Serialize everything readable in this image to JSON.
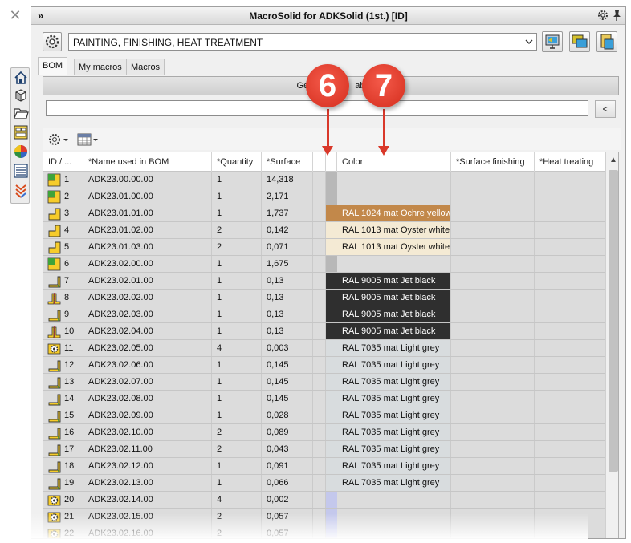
{
  "app": {
    "close_glyph": "✕",
    "title": "MacroSolid for ADKSolid (1st.) [ID]",
    "collapse_glyph": "»"
  },
  "toolbar": {
    "category_value": "PAINTING, FINISHING, HEAT TREATMENT"
  },
  "tabs": [
    {
      "label": "BOM",
      "active": true
    },
    {
      "label": "My macros",
      "active": false
    },
    {
      "label": "Macros",
      "active": false
    }
  ],
  "generate_button_label": "Ge",
  "generate_button_label_tail": "ab",
  "search": {
    "value": "",
    "back_label": "<"
  },
  "columns": [
    "ID / ...",
    "*Name used in BOM",
    "*Quantity",
    "*Surface",
    "",
    "Color",
    "*Surface finishing",
    "*Heat treating"
  ],
  "rows": [
    {
      "id": "1",
      "icon": "assembly-icon",
      "name": "ADK23.00.00.00",
      "qty": "1",
      "surface": "14,318",
      "color": "",
      "swatch": "#b8b8b8"
    },
    {
      "id": "2",
      "icon": "assembly-icon",
      "name": "ADK23.01.00.00",
      "qty": "1",
      "surface": "2,171",
      "color": "",
      "swatch": "#b8b8b8"
    },
    {
      "id": "3",
      "icon": "part-icon",
      "name": "ADK23.01.01.00",
      "qty": "1",
      "surface": "1,737",
      "color": "RAL 1024 mat Ochre yellow",
      "swatch": "#c2884a"
    },
    {
      "id": "4",
      "icon": "part-icon",
      "name": "ADK23.01.02.00",
      "qty": "2",
      "surface": "0,142",
      "color": "RAL 1013 mat Oyster white",
      "swatch": "#f4ead4"
    },
    {
      "id": "5",
      "icon": "part-icon",
      "name": "ADK23.01.03.00",
      "qty": "2",
      "surface": "0,071",
      "color": "RAL 1013 mat Oyster white",
      "swatch": "#f4ead4"
    },
    {
      "id": "6",
      "icon": "assembly-icon",
      "name": "ADK23.02.00.00",
      "qty": "1",
      "surface": "1,675",
      "color": "",
      "swatch": "#b8b8b8"
    },
    {
      "id": "7",
      "icon": "angle-icon",
      "name": "ADK23.02.01.00",
      "qty": "1",
      "surface": "0,13",
      "color": "RAL 9005 mat Jet black",
      "swatch": "#2f2f2f"
    },
    {
      "id": "8",
      "icon": "mirror-angle-icon",
      "name": "ADK23.02.02.00",
      "qty": "1",
      "surface": "0,13",
      "color": "RAL 9005 mat Jet black",
      "swatch": "#2f2f2f"
    },
    {
      "id": "9",
      "icon": "angle-icon",
      "name": "ADK23.02.03.00",
      "qty": "1",
      "surface": "0,13",
      "color": "RAL 9005 mat Jet black",
      "swatch": "#2f2f2f"
    },
    {
      "id": "10",
      "icon": "mirror-angle-icon",
      "name": "ADK23.02.04.00",
      "qty": "1",
      "surface": "0,13",
      "color": "RAL 9005 mat Jet black",
      "swatch": "#2f2f2f"
    },
    {
      "id": "11",
      "icon": "gear-part-icon",
      "name": "ADK23.02.05.00",
      "qty": "4",
      "surface": "0,003",
      "color": "RAL 7035 mat Light grey",
      "swatch": "#d8dcde"
    },
    {
      "id": "12",
      "icon": "angle-icon",
      "name": "ADK23.02.06.00",
      "qty": "1",
      "surface": "0,145",
      "color": "RAL 7035 mat Light grey",
      "swatch": "#d8dcde"
    },
    {
      "id": "13",
      "icon": "angle-icon",
      "name": "ADK23.02.07.00",
      "qty": "1",
      "surface": "0,145",
      "color": "RAL 7035 mat Light grey",
      "swatch": "#d8dcde"
    },
    {
      "id": "14",
      "icon": "angle-icon",
      "name": "ADK23.02.08.00",
      "qty": "1",
      "surface": "0,145",
      "color": "RAL 7035 mat Light grey",
      "swatch": "#d8dcde"
    },
    {
      "id": "15",
      "icon": "angle-icon",
      "name": "ADK23.02.09.00",
      "qty": "1",
      "surface": "0,028",
      "color": "RAL 7035 mat Light grey",
      "swatch": "#d8dcde"
    },
    {
      "id": "16",
      "icon": "angle-icon",
      "name": "ADK23.02.10.00",
      "qty": "2",
      "surface": "0,089",
      "color": "RAL 7035 mat Light grey",
      "swatch": "#d8dcde"
    },
    {
      "id": "17",
      "icon": "angle-icon",
      "name": "ADK23.02.11.00",
      "qty": "2",
      "surface": "0,043",
      "color": "RAL 7035 mat Light grey",
      "swatch": "#d8dcde"
    },
    {
      "id": "18",
      "icon": "angle-icon",
      "name": "ADK23.02.12.00",
      "qty": "1",
      "surface": "0,091",
      "color": "RAL 7035 mat Light grey",
      "swatch": "#d8dcde"
    },
    {
      "id": "19",
      "icon": "angle-icon",
      "name": "ADK23.02.13.00",
      "qty": "1",
      "surface": "0,066",
      "color": "RAL 7035 mat Light grey",
      "swatch": "#d8dcde"
    },
    {
      "id": "20",
      "icon": "gear-part-icon",
      "name": "ADK23.02.14.00",
      "qty": "4",
      "surface": "0,002",
      "color": "",
      "swatch": "#c4c8ec"
    },
    {
      "id": "21",
      "icon": "gear-part-icon",
      "name": "ADK23.02.15.00",
      "qty": "2",
      "surface": "0,057",
      "color": "",
      "swatch": "#c4c8ec"
    },
    {
      "id": "22",
      "icon": "gear-part-icon",
      "name": "ADK23.02.16.00",
      "qty": "2",
      "surface": "0,057",
      "color": "",
      "swatch": "#c4c8ec"
    }
  ],
  "callouts": [
    "6",
    "7"
  ],
  "side_icons": [
    "home-icon",
    "cube-icon",
    "folder-icon",
    "properties-icon",
    "color-wheel-icon",
    "list-icon",
    "chevrons-down-icon"
  ]
}
